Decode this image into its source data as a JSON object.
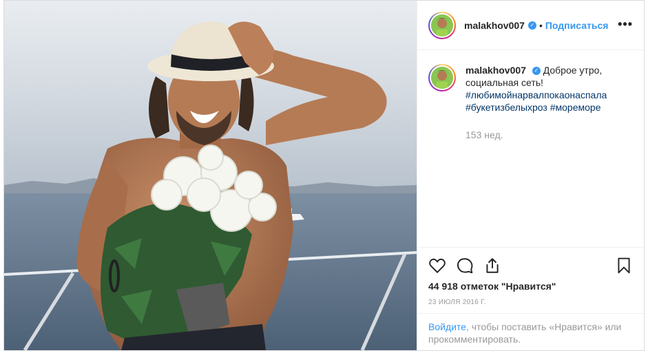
{
  "post": {
    "username": "malakhov007",
    "follow_label": "Подписаться",
    "dot": "•",
    "more_label": "•••",
    "caption_text": "Доброе утро, социальная сеть!",
    "hashtags": [
      "#любимойнарвалпокаонаспала",
      "#букетизбелыхроз",
      "#мореморе"
    ],
    "time_ago": "153 нед.",
    "likes": "44 918 отметок \"Нравится\"",
    "date": "23 июля 2016 г.",
    "login_link": "Войдите",
    "login_text": ", чтобы поставить «Нравится» или прокомментировать."
  },
  "icons": {
    "verified": "verified-badge-icon",
    "like": "heart-icon",
    "comment": "comment-bubble-icon",
    "share": "share-icon",
    "save": "bookmark-icon",
    "more": "ellipsis-icon"
  },
  "colors": {
    "accent": "#3897f0",
    "hashtag": "#003569",
    "muted": "#999999",
    "text": "#262626"
  }
}
